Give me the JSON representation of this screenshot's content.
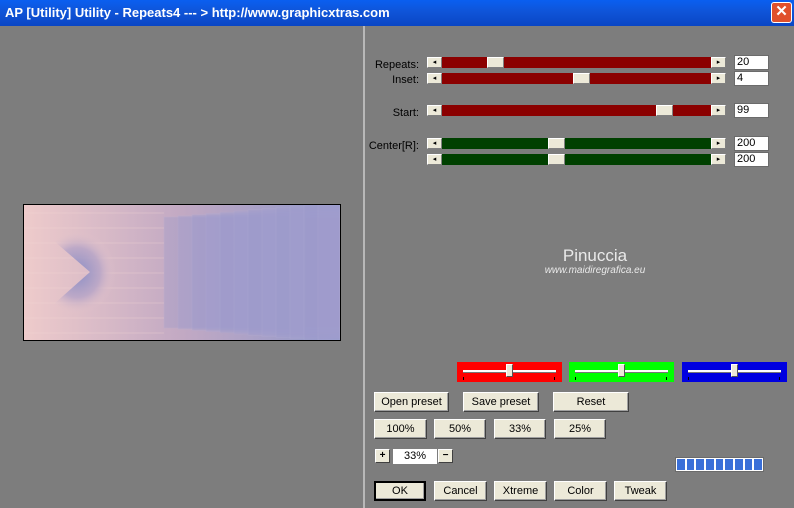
{
  "window": {
    "title": "AP [Utility]  Utility - Repeats4     --- > http://www.graphicxtras.com",
    "close_symbol": "✕"
  },
  "sliders": [
    {
      "label": "Repeats:",
      "value": "20",
      "fraction": 0.18,
      "color": "red"
    },
    {
      "label": "Inset:",
      "value": "4",
      "fraction": 0.52,
      "color": "red"
    },
    {
      "label": "Start:",
      "value": "99",
      "fraction": 0.85,
      "color": "red"
    },
    {
      "label": "Center[R]:",
      "value": "200",
      "fraction": 0.42,
      "color": "green"
    },
    {
      "label": "",
      "value": "200",
      "fraction": 0.42,
      "color": "green"
    }
  ],
  "watermark": {
    "name": "Pinuccia",
    "url": "www.maidiregrafica.eu"
  },
  "color_sliders": [
    {
      "name": "red",
      "color": "#ff0000",
      "fraction": 0.5
    },
    {
      "name": "green",
      "color": "#00ff00",
      "fraction": 0.5
    },
    {
      "name": "blue",
      "color": "#0000e0",
      "fraction": 0.5
    }
  ],
  "buttons": {
    "open_preset": "Open preset",
    "save_preset": "Save preset",
    "reset": "Reset",
    "zoom_100": "100%",
    "zoom_50": "50%",
    "zoom_33": "33%",
    "zoom_25": "25%",
    "zoom_in": "+",
    "zoom_out": "−",
    "ok": "OK",
    "cancel": "Cancel",
    "xtreme": "Xtreme",
    "color": "Color",
    "tweak": "Tweak"
  },
  "zoom_value": "33%",
  "progress_blocks": 9,
  "colors": {
    "title_bar": "#0a58e6",
    "panel_bg": "#7d7d7d",
    "red_track": "#8b0000",
    "green_track": "#004000",
    "preview_pink": "#eecbcb",
    "preview_blue": "#8f98cc"
  }
}
